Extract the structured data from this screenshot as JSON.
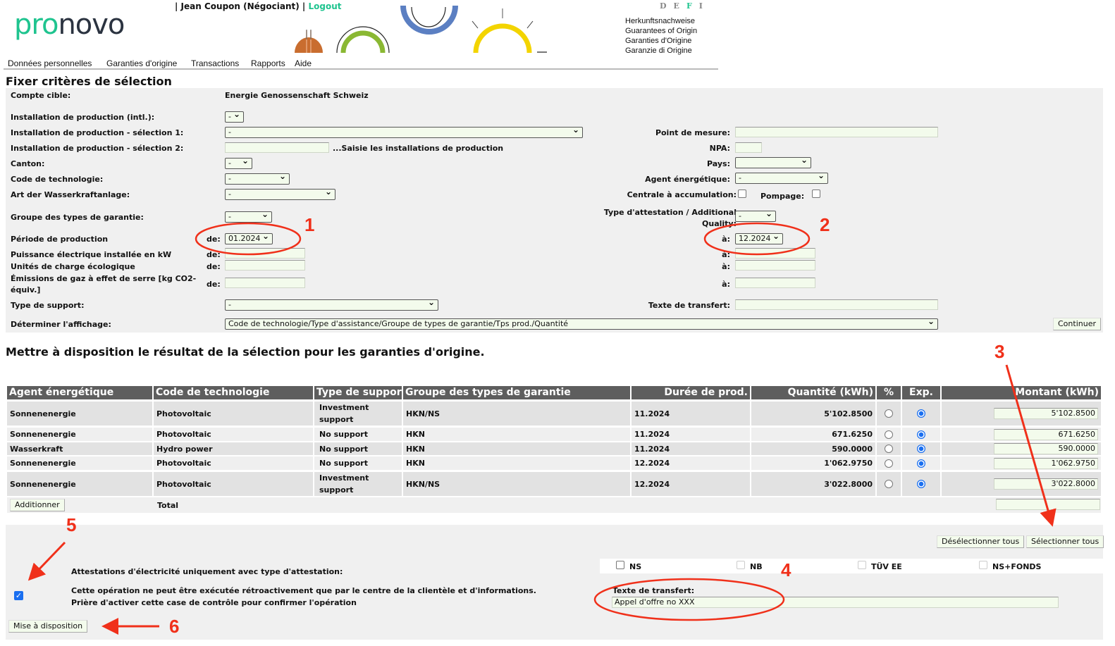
{
  "header": {
    "logo": "pronovo",
    "user": "| Jean Coupon (Négociant) |",
    "logout": "Logout",
    "languages": [
      "D",
      "E",
      "F",
      "I"
    ],
    "active_language": "F",
    "taglines": [
      "Herkunftsnachweise",
      "Guarantees of Origin",
      "Garanties d'Origine",
      "Garanzie di Origine"
    ],
    "nav": [
      "Données personnelles",
      "Garanties d'origine",
      "Transactions",
      "Rapports",
      "Aide"
    ],
    "brand_color": "#1fc48f"
  },
  "criteria": {
    "title": "Fixer critères de sélection",
    "compte_label": "Compte cible:",
    "compte_value": "Energie Genossenschaft Schweiz",
    "inst_intl_label": "Installation de production (intl.):",
    "inst_intl_value": "-",
    "inst_sel1_label": "Installation de production - sélection 1:",
    "inst_sel1_value": "-",
    "inst_sel2_label": "Installation de production - sélection 2:",
    "inst_sel2_hint": "...Saisie les installations de production",
    "canton_label": "Canton:",
    "canton_value": "-",
    "techcode_label": "Code de technologie:",
    "techcode_value": "-",
    "wasser_label": "Art der Wasserkraftanlage:",
    "wasser_value": "-",
    "groupe_label": "Groupe des types de garantie:",
    "groupe_value": "-",
    "periode_label": "Période de production",
    "de": "de:",
    "a": "à:",
    "periode_from": "01.2024",
    "periode_to": "12.2024",
    "puissance_label": "Puissance électrique installée en kW",
    "unites_label": "Unités de charge écologique",
    "emissions_label": "Émissions de gaz à effet de serre [kg CO2-équiv.]",
    "support_label": "Type de support:",
    "support_value": "-",
    "affichage_label": "Déterminer l'affichage:",
    "affichage_value": "Code de technologie/Type d'assistance/Groupe de types de garantie/Tps prod./Quantité",
    "continuer": "Continuer",
    "point_label": "Point de mesure:",
    "npa_label": "NPA:",
    "pays_label": "Pays:",
    "pays_value": "",
    "agent_label": "Agent énergétique:",
    "agent_value": "-",
    "centrale_label": "Centrale à accumulation:",
    "pompage_label": "Pompage:",
    "attest_label": "Type d'attestation / Additional Quality:",
    "attest_value": "-",
    "texte_label": "Texte de transfert:"
  },
  "results": {
    "title": "Mettre à disposition le résultat de la sélection pour les garanties d'origine.",
    "columns": [
      "Agent énergétique",
      "Code de technologie",
      "Type de support",
      "Groupe des types de garantie",
      "Durée de prod.",
      "Quantité (kWh)",
      "%",
      "Exp.",
      "Montant (kWh)"
    ],
    "rows": [
      {
        "agent": "Sonnenenergie",
        "code": "Photovoltaic",
        "support": "Investment support",
        "groupe": "HKN/NS",
        "duree": "11.2024",
        "quantite": "5'102.8500",
        "pct": false,
        "exp": true,
        "montant": "5'102.8500"
      },
      {
        "agent": "Sonnenenergie",
        "code": "Photovoltaic",
        "support": "No support",
        "groupe": "HKN",
        "duree": "11.2024",
        "quantite": "671.6250",
        "pct": false,
        "exp": true,
        "montant": "671.6250"
      },
      {
        "agent": "Wasserkraft",
        "code": "Hydro power",
        "support": "No support",
        "groupe": "HKN",
        "duree": "11.2024",
        "quantite": "590.0000",
        "pct": false,
        "exp": true,
        "montant": "590.0000"
      },
      {
        "agent": "Sonnenenergie",
        "code": "Photovoltaic",
        "support": "No support",
        "groupe": "HKN",
        "duree": "12.2024",
        "quantite": "1'062.9750",
        "pct": false,
        "exp": true,
        "montant": "1'062.9750"
      },
      {
        "agent": "Sonnenenergie",
        "code": "Photovoltaic",
        "support": "Investment support",
        "groupe": "HKN/NS",
        "duree": "12.2024",
        "quantite": "3'022.8000",
        "pct": false,
        "exp": true,
        "montant": "3'022.8000"
      }
    ],
    "additionner": "Additionner",
    "total_label": "Total",
    "total_value": ""
  },
  "bottom": {
    "deselect_all": "Désélectionner tous",
    "select_all": "Sélectionner tous",
    "attest_label": "Attestations d'électricité uniquement avec type d'attestation:",
    "attest_options": [
      {
        "label": "NS",
        "checked": false,
        "enabled": true
      },
      {
        "label": "NB",
        "checked": false,
        "enabled": false
      },
      {
        "label": "TÜV EE",
        "checked": false,
        "enabled": false
      },
      {
        "label": "NS+FONDS",
        "checked": false,
        "enabled": false
      }
    ],
    "confirm_line1": "Cette opération ne peut être exécutée rétroactivement que par le centre de la clientèle et d'informations.",
    "confirm_line2": "Prière d'activer cette case de contrôle pour confirmer l'opération",
    "confirm_checked": true,
    "texte_label": "Texte de transfert:",
    "texte_value": "Appel d'offre no XXX",
    "submit": "Mise à disposition"
  },
  "annotations": [
    "1",
    "2",
    "3",
    "4",
    "5",
    "6"
  ],
  "annotation_color": "#f0301a"
}
